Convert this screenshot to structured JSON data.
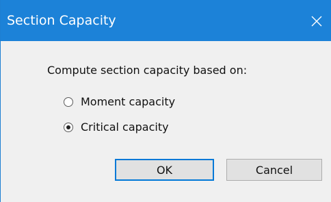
{
  "window": {
    "title": "Section Capacity",
    "close_icon": "close-icon"
  },
  "dialog": {
    "prompt": "Compute section capacity based on:",
    "options": [
      {
        "label": "Moment capacity",
        "selected": false
      },
      {
        "label": "Critical capacity",
        "selected": true
      }
    ],
    "ok_label": "OK",
    "cancel_label": "Cancel"
  },
  "colors": {
    "titlebar": "#1c82d8",
    "dialog_bg": "#f0f0f0",
    "default_button_border": "#0078d7"
  }
}
